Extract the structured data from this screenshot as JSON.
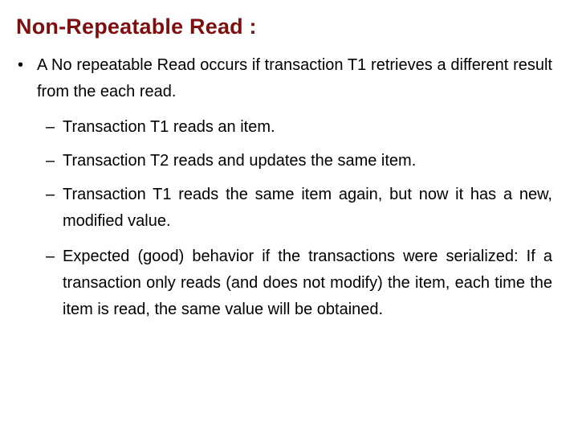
{
  "slide": {
    "title": "Non-Repeatable Read :",
    "bullets": [
      {
        "marker": "•",
        "text": "A No repeatable Read occurs if transaction T1 retrieves a different result from the each read."
      }
    ],
    "sub_bullets": [
      {
        "marker": "–",
        "text": "Transaction T1 reads an item."
      },
      {
        "marker": "–",
        "text": "Transaction T2 reads and updates the same item."
      },
      {
        "marker": "–",
        "text": "Transaction T1 reads the same item again, but now it has a new, modified value."
      },
      {
        "marker": "–",
        "text": "Expected (good) behavior if the transactions were serialized: If a transaction only reads (and does not modify) the item, each time the item is read, the same value will be obtained."
      }
    ],
    "colors": {
      "title": "#7f0f0f",
      "body": "#000000",
      "background": "#ffffff"
    }
  }
}
